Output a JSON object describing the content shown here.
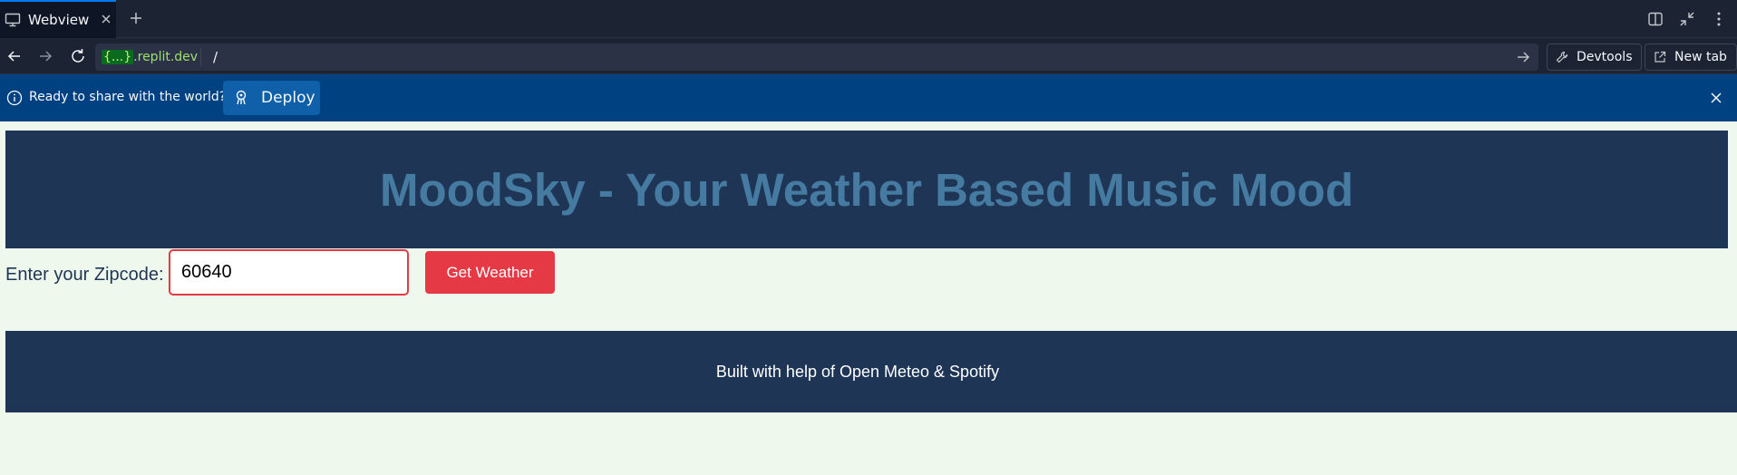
{
  "browser": {
    "tab": {
      "title": "Webview",
      "icon": "monitor-icon"
    },
    "url": {
      "domain_brace": "{...}",
      "domain_suffix": ".replit.dev",
      "path": "/"
    },
    "devtools_label": "Devtools",
    "new_tab_label": "New tab"
  },
  "banner": {
    "message": "Ready to share with the world?",
    "deploy_label": "Deploy"
  },
  "app": {
    "title": "MoodSky - Your Weather Based Music Mood",
    "zip_label": "Enter your Zipcode:",
    "zip_value": "60640",
    "button_label": "Get Weather",
    "footer_text": "Built with help of Open Meteo & Spotify"
  },
  "colors": {
    "header_bg": "#1f3556",
    "title_color": "#467ba1",
    "accent_red": "#e63946",
    "page_bg": "#eff8ec",
    "banner_bg": "#004182"
  }
}
